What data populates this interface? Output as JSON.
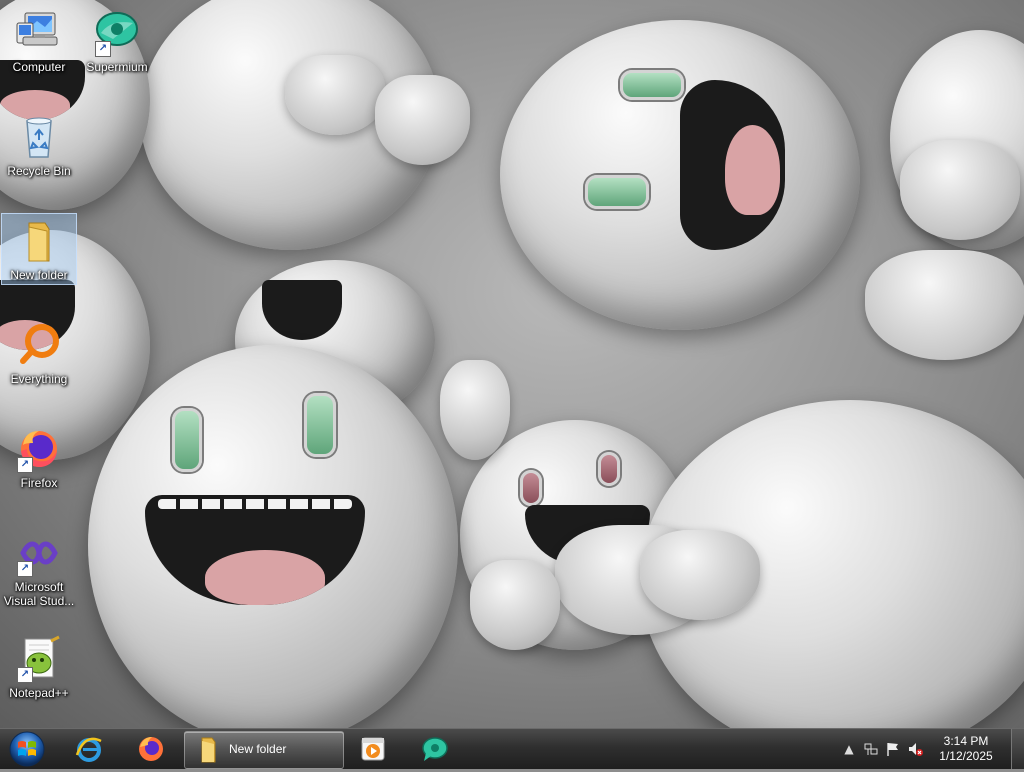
{
  "desktop": {
    "icons": [
      {
        "label": "Computer",
        "icon": "computer-icon"
      },
      {
        "label": "Supermium",
        "icon": "supermium-icon"
      },
      {
        "label": "Recycle Bin",
        "icon": "recycle-bin-icon"
      },
      {
        "label": "New folder",
        "icon": "folder-icon",
        "selected": true
      },
      {
        "label": "Everything",
        "icon": "everything-search-icon"
      },
      {
        "label": "Firefox",
        "icon": "firefox-icon"
      },
      {
        "label": "Microsoft Visual Stud...",
        "icon": "visual-studio-icon"
      },
      {
        "label": "Notepad++",
        "icon": "notepadpp-icon"
      }
    ]
  },
  "taskbar": {
    "pinned": [
      {
        "icon": "internet-explorer-icon"
      },
      {
        "icon": "firefox-icon"
      },
      {
        "icon": "media-player-icon"
      },
      {
        "icon": "supermium-icon"
      }
    ],
    "tasks": [
      {
        "label": "New folder",
        "icon": "folder-icon",
        "active": true
      }
    ],
    "tray": {
      "icons": [
        "show-hidden-icons-chevron",
        "network-icon",
        "action-center-flag-icon",
        "volume-muted-icon"
      ],
      "time": "3:14 PM",
      "date": "1/12/2025"
    }
  },
  "colors": {
    "taskbar": "#2f2f2f",
    "selection": "#a0c8f0",
    "eye_green": "#5fa57a",
    "tongue": "#d9a3a5"
  }
}
